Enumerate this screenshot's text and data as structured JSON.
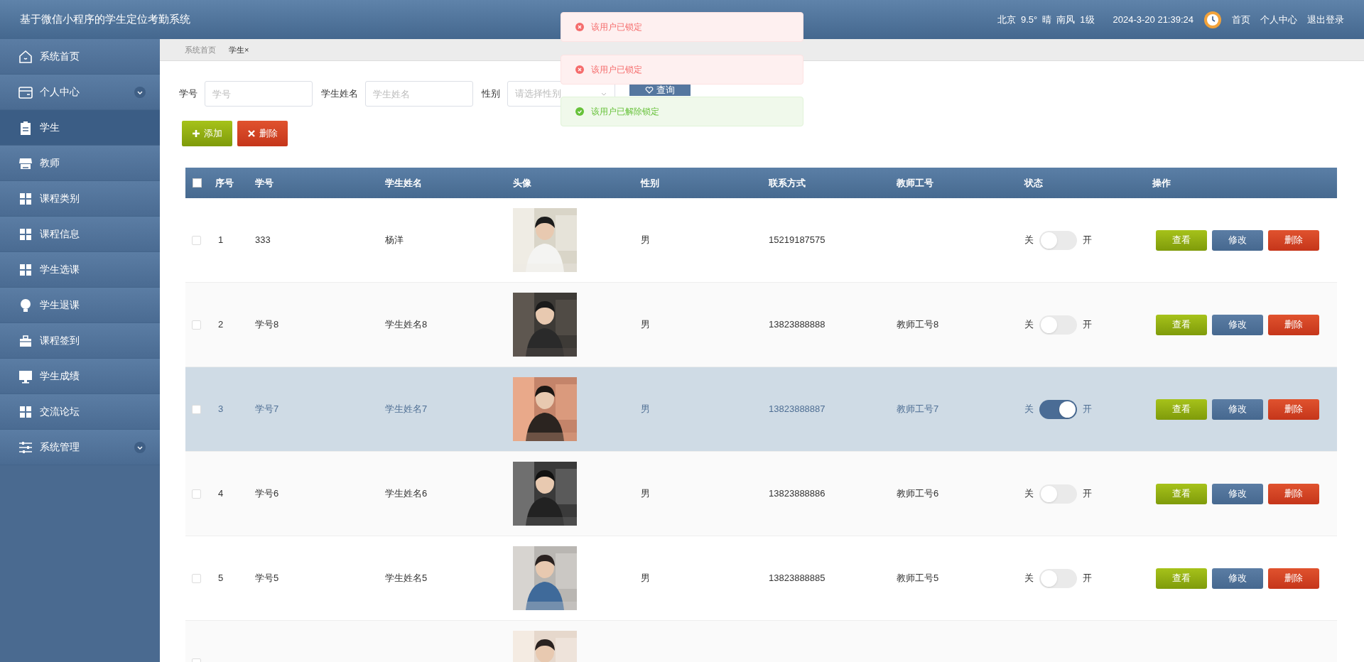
{
  "app_title": "基于微信小程序的学生定位考勤系统",
  "header": {
    "weather": [
      "北京",
      "9.5°",
      "晴",
      "南风",
      "1级"
    ],
    "datetime": "2024-3-20 21:39:24",
    "links": [
      "首页",
      "个人中心",
      "退出登录"
    ]
  },
  "sidebar": {
    "items": [
      {
        "label": "系统首页",
        "selected": false,
        "expandable": false
      },
      {
        "label": "个人中心",
        "selected": false,
        "expandable": true
      },
      {
        "label": "学生",
        "selected": true,
        "expandable": false
      },
      {
        "label": "教师",
        "selected": false,
        "expandable": false
      },
      {
        "label": "课程类别",
        "selected": false,
        "expandable": false
      },
      {
        "label": "课程信息",
        "selected": false,
        "expandable": false
      },
      {
        "label": "学生选课",
        "selected": false,
        "expandable": false
      },
      {
        "label": "学生退课",
        "selected": false,
        "expandable": false
      },
      {
        "label": "课程签到",
        "selected": false,
        "expandable": false
      },
      {
        "label": "学生成绩",
        "selected": false,
        "expandable": false
      },
      {
        "label": "交流论坛",
        "selected": false,
        "expandable": false
      },
      {
        "label": "系统管理",
        "selected": false,
        "expandable": true
      }
    ]
  },
  "breadcrumb": [
    {
      "label": "系统首页",
      "selected": false,
      "closable": false
    },
    {
      "label": "学生",
      "selected": true,
      "closable": true,
      "close": "×"
    }
  ],
  "toasts": [
    {
      "kind": "error",
      "text": "该用户已锁定"
    },
    {
      "kind": "error",
      "text": "该用户已锁定"
    },
    {
      "kind": "success",
      "text": "该用户已解除锁定"
    }
  ],
  "search": {
    "fields": [
      {
        "label": "学号",
        "placeholder": "学号",
        "kind": "text"
      },
      {
        "label": "学生姓名",
        "placeholder": "学生姓名",
        "kind": "text"
      },
      {
        "label": "性别",
        "placeholder": "请选择性别",
        "kind": "select"
      }
    ],
    "button": "查询"
  },
  "actions": [
    {
      "label": "添加",
      "kind": "add"
    },
    {
      "label": "删除",
      "kind": "delete"
    }
  ],
  "table": {
    "select_all_checked": false,
    "columns": [
      "序号",
      "学号",
      "学生姓名",
      "头像",
      "性别",
      "联系方式",
      "教师工号",
      "状态",
      "操作"
    ],
    "rows": [
      {
        "selected": false,
        "index": "1",
        "student_no": "333",
        "name": "杨洋",
        "gender": "男",
        "phone": "15219187575",
        "status_on": false,
        "off_label": "关",
        "on_label": "开",
        "actions": [
          "查看",
          "修改",
          "删除"
        ]
      },
      {
        "selected": false,
        "index": "2",
        "student_no": "学号8",
        "name": "学生姓名8",
        "gender": "男",
        "phone": "13823888888",
        "teacher_no": "教师工号8",
        "status_on": false,
        "off_label": "关",
        "on_label": "开",
        "actions": [
          "查看",
          "修改",
          "删除"
        ]
      },
      {
        "selected": true,
        "index": "3",
        "student_no": "学号7",
        "name": "学生姓名7",
        "gender": "男",
        "phone": "13823888887",
        "teacher_no": "教师工号7",
        "status_on": true,
        "off_label": "关",
        "on_label": "开",
        "actions": [
          "查看",
          "修改",
          "删除"
        ]
      },
      {
        "selected": false,
        "index": "4",
        "student_no": "学号6",
        "name": "学生姓名6",
        "gender": "男",
        "phone": "13823888886",
        "teacher_no": "教师工号6",
        "status_on": false,
        "off_label": "关",
        "on_label": "开",
        "actions": [
          "查看",
          "修改",
          "删除"
        ]
      },
      {
        "selected": false,
        "index": "5",
        "student_no": "学号5",
        "name": "学生姓名5",
        "gender": "男",
        "phone": "13823888885",
        "teacher_no": "教师工号5",
        "status_on": false,
        "off_label": "关",
        "on_label": "开",
        "actions": [
          "查看",
          "修改",
          "删除"
        ]
      },
      {
        "selected": false
      }
    ]
  }
}
